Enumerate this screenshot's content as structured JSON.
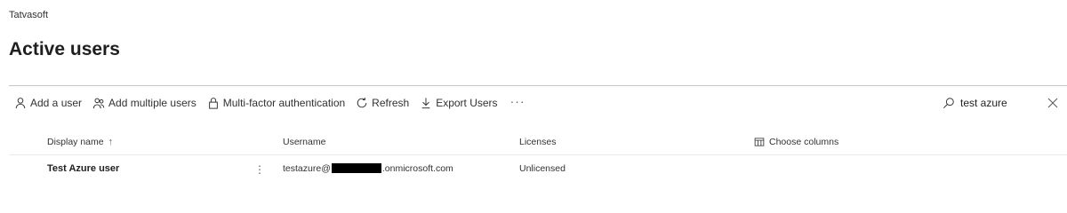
{
  "organization": "Tatvasoft",
  "page_title": "Active users",
  "toolbar": {
    "add_user": "Add a user",
    "add_multiple": "Add multiple users",
    "mfa": "Multi-factor authentication",
    "refresh": "Refresh",
    "export": "Export Users",
    "more": "···"
  },
  "search": {
    "value": "test azure"
  },
  "table": {
    "columns": {
      "display_name": "Display name",
      "sort_indicator": "↑",
      "username": "Username",
      "licenses": "Licenses",
      "choose_columns": "Choose columns"
    },
    "rows": [
      {
        "display_name": "Test Azure user",
        "row_menu": "⋮",
        "username_prefix": "testazure@",
        "username_suffix": ".onmicrosoft.com",
        "licenses": "Unlicensed"
      }
    ]
  }
}
